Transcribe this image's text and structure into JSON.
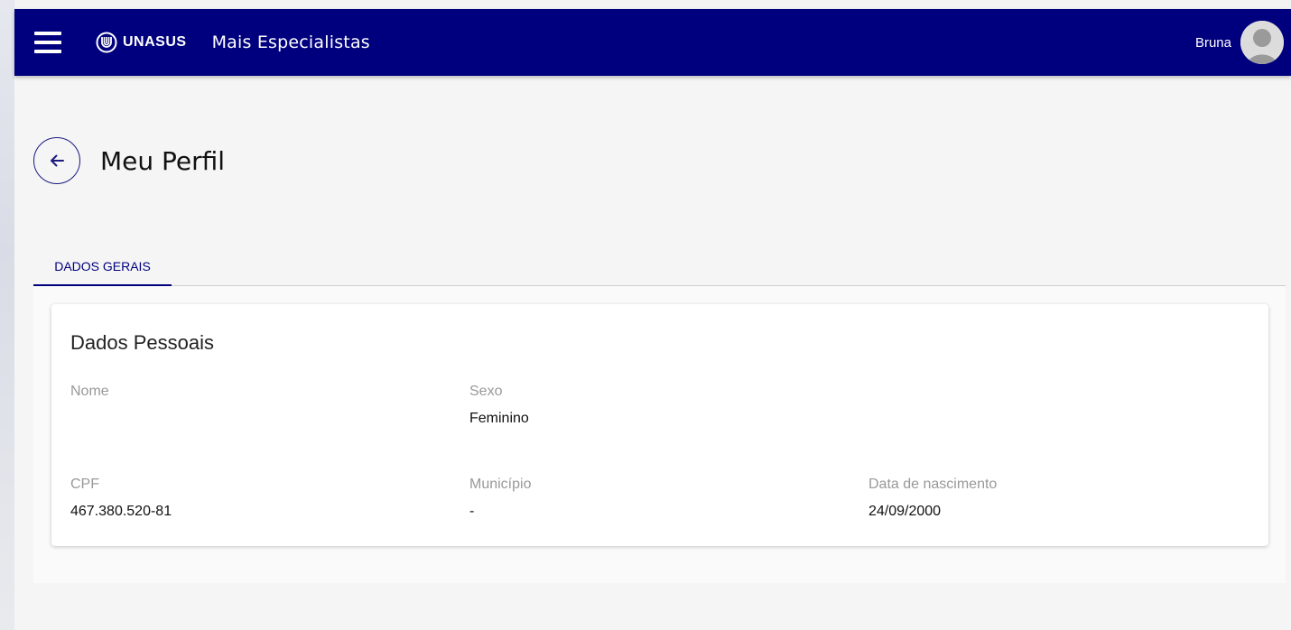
{
  "header": {
    "logo_text": "UNASUS",
    "app_name": "Mais Especialistas",
    "user_name": "Bruna"
  },
  "page": {
    "title": "Meu Perfil"
  },
  "tabs": [
    {
      "label": "DADOS GERAIS",
      "active": true
    }
  ],
  "card": {
    "title": "Dados Pessoais",
    "fields": {
      "nome": {
        "label": "Nome",
        "value": ""
      },
      "sexo": {
        "label": "Sexo",
        "value": "Feminino"
      },
      "cpf": {
        "label": "CPF",
        "value": "467.380.520-81"
      },
      "municipio": {
        "label": "Município",
        "value": "-"
      },
      "nascimento": {
        "label": "Data de nascimento",
        "value": "24/09/2000"
      }
    }
  },
  "colors": {
    "brand": "#00007e",
    "label": "#999999",
    "text": "#111111"
  },
  "icons": {
    "menu": "menu-icon",
    "logo": "unasus-logo-icon",
    "avatar": "user-avatar-icon",
    "back": "arrow-left-icon"
  }
}
